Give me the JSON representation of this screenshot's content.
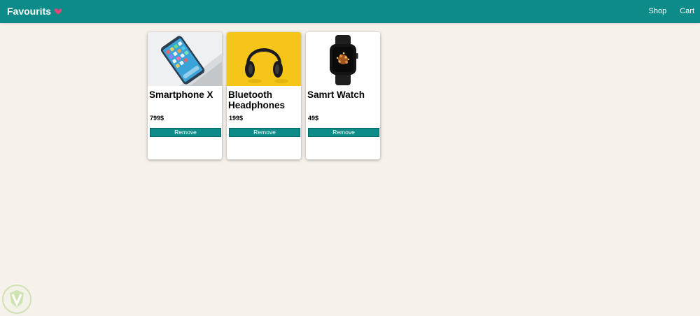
{
  "navbar": {
    "brand": "Favourits",
    "links": [
      "Shop",
      "Cart"
    ]
  },
  "colors": {
    "primary": "#0d8b88",
    "background": "#f6f1eb",
    "heart": "#e8437a"
  },
  "icons": {
    "brand_icon": "heart-icon",
    "watermark": "shield-logo"
  },
  "favourites": [
    {
      "title": "Smartphone X",
      "price": "799$",
      "button": "Remove",
      "image": "smartphone on laptop"
    },
    {
      "title": "Bluetooth Headphones",
      "price": "199$",
      "button": "Remove",
      "image": "black headphones on yellow"
    },
    {
      "title": "Samrt Watch",
      "price": "49$",
      "button": "Remove",
      "image": "smart watch"
    }
  ]
}
